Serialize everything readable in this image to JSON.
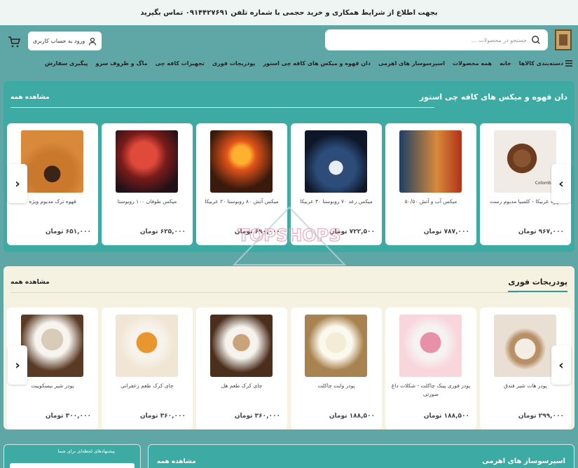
{
  "topbar": {
    "text": "بجهت اطلاع از شرایط همکاری و خرید حجمی با شماره تلفن ۰۹۱۴۴۲۷۶۹۱ تماس بگیرید"
  },
  "header": {
    "search_placeholder": "جستجو در محصولات ...",
    "login_label": "ورود به حساب کاربری"
  },
  "nav": {
    "items": [
      "دسته‌بندی کالاها",
      "خانه",
      "همه محصولات",
      "اسپرسوساز های اهرمی",
      "دان قهوه و میکس های کافه چی استور",
      "پودریجات فوری",
      "تجهیزات کافه چی",
      "ماگ و ظروف سرو",
      "پیگیری سفارش"
    ]
  },
  "section1": {
    "title": "دان قهوه و میکس های کافه چی استور",
    "view_all": "مشاهده همه",
    "products": [
      {
        "name": "قهوه عربیکا - کلمبیا مدیوم رست",
        "price": "۹۶۷,۰۰۰ تومان",
        "badge": "Colombia"
      },
      {
        "name": "میکس آب و آتش ۵۰/۵۰",
        "price": "۷۸۷,۰۰۰ تومان"
      },
      {
        "name": "میکس رعد ۷۰ روبوستا ۳۰ عربیکا",
        "price": "۷۲۲,۵۰۰ تومان"
      },
      {
        "name": "میکس آتش ۸۰ روبوستا ۲۰ عربیکا",
        "price": "۶۹۰,۰۰۰ تومان"
      },
      {
        "name": "میکس طوفان ۱۰۰ روبوستا",
        "price": "۶۲۵,۰۰۰ تومان"
      },
      {
        "name": "قهوه ترک مدیوم ویژه",
        "price": "۶۵۱,۰۰۰ تومان"
      }
    ]
  },
  "section2": {
    "title": "پودریجات فوری",
    "view_all": "مشاهده همه",
    "products": [
      {
        "name": "پودر هات شیر فندق",
        "price": "۲۹۹,۰۰۰ تومان"
      },
      {
        "name": "پودر فوری پینک چاکلت - شکلات داغ صورتی",
        "price": "۱۸۸,۵۰۰ تومان"
      },
      {
        "name": "پودر وایت چاکلت",
        "price": "۱۸۸,۵۰۰ تومان"
      },
      {
        "name": "چای کرک طعم هل",
        "price": "۳۶۰,۰۰۰ تومان"
      },
      {
        "name": "چای کرک طعم زعفرانی",
        "price": "۳۶۰,۰۰۰ تومان"
      },
      {
        "name": "پودر شیر بیسکوییت",
        "price": "۳۰۰,۰۰۰ تومان"
      }
    ]
  },
  "section3": {
    "title": "اسپرسوساز های اهرمی",
    "view_all": "مشاهده همه"
  },
  "sidebar_box": {
    "title": "پیشنهادهای لحظه‌ای برای شما"
  },
  "watermark": {
    "text": "TOPSHOPS"
  },
  "colors": {
    "accent": "#3eaaa4",
    "page_bg": "#5fa6a6",
    "section2_bg": "#f5f2e1"
  }
}
